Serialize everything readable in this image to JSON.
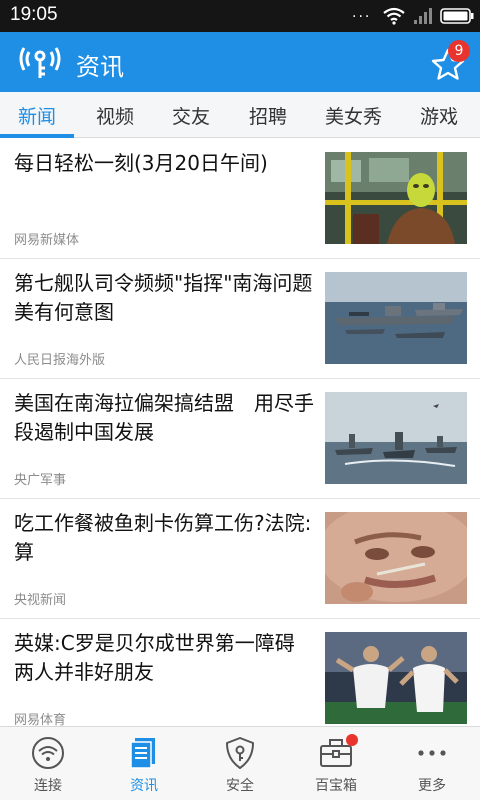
{
  "status_bar": {
    "time": "19:05",
    "dots": "···"
  },
  "header": {
    "title": "资讯",
    "favorites_badge": "9"
  },
  "tabs": [
    {
      "label": "新闻",
      "active": true
    },
    {
      "label": "视频"
    },
    {
      "label": "交友"
    },
    {
      "label": "招聘"
    },
    {
      "label": "美女秀"
    },
    {
      "label": "游戏"
    }
  ],
  "news": [
    {
      "headline": "每日轻松一刻(3月20日午间)",
      "source": "网易新媒体"
    },
    {
      "headline": "第七舰队司令频频\"指挥\"南海问题 美有何意图",
      "source": "人民日报海外版"
    },
    {
      "headline": "美国在南海拉偏架搞结盟　用尽手段遏制中国发展",
      "source": "央广军事"
    },
    {
      "headline": "吃工作餐被鱼刺卡伤算工伤?法院:算",
      "source": "央视新闻"
    },
    {
      "headline": "英媒:C罗是贝尔成世界第一障碍 两人并非好朋友",
      "source": "网易体育"
    }
  ],
  "bottom_nav": [
    {
      "label": "连接"
    },
    {
      "label": "资讯",
      "active": true
    },
    {
      "label": "安全"
    },
    {
      "label": "百宝箱"
    },
    {
      "label": "更多"
    }
  ],
  "colors": {
    "accent": "#1f8fe6",
    "badge": "#e8342c",
    "status_bar": "#151515"
  }
}
